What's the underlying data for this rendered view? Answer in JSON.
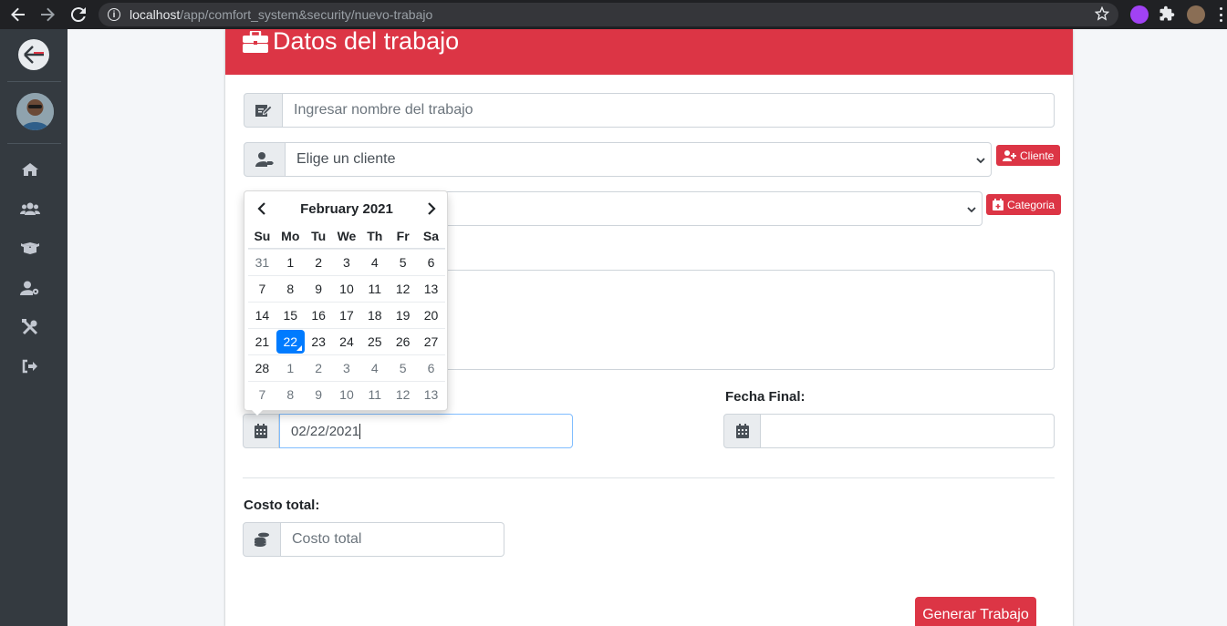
{
  "browser": {
    "url_host": "localhost",
    "url_path": "/app/comfort_system&security/nuevo-trabajo"
  },
  "card": {
    "title": "Datos del trabajo"
  },
  "form": {
    "job_name_placeholder": "Ingresar nombre del trabajo",
    "client_select_value": "Elige un cliente",
    "client_button": "Cliente",
    "category_button": "Categoria",
    "start_date_value": "02/22/2021",
    "end_date_label": "Fecha Final:",
    "end_date_value": "",
    "cost_label": "Costo total:",
    "cost_placeholder": "Costo total",
    "submit_button": "Generar Trabajo"
  },
  "datepicker": {
    "month_label": "February 2021",
    "weekdays": [
      "Su",
      "Mo",
      "Tu",
      "We",
      "Th",
      "Fr",
      "Sa"
    ],
    "weeks": [
      [
        "31",
        "1",
        "2",
        "3",
        "4",
        "5",
        "6"
      ],
      [
        "7",
        "8",
        "9",
        "10",
        "11",
        "12",
        "13"
      ],
      [
        "14",
        "15",
        "16",
        "17",
        "18",
        "19",
        "20"
      ],
      [
        "21",
        "22",
        "23",
        "24",
        "25",
        "26",
        "27"
      ],
      [
        "28",
        "1",
        "2",
        "3",
        "4",
        "5",
        "6"
      ],
      [
        "7",
        "8",
        "9",
        "10",
        "11",
        "12",
        "13"
      ]
    ],
    "selected_day": "22"
  },
  "colors": {
    "brand_red": "#dc3545",
    "sidebar": "#343a40",
    "datepicker_active": "#007bff"
  }
}
